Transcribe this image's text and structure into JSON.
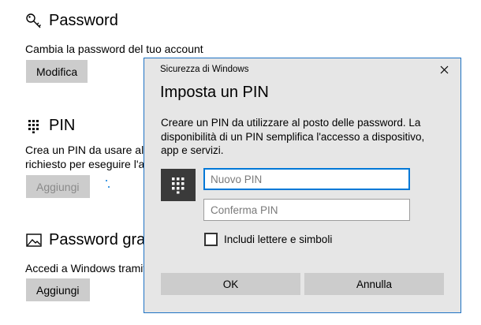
{
  "settings": {
    "password": {
      "title": "Password",
      "icon": "key-icon",
      "description": "Cambia la password del tuo account",
      "button": "Modifica"
    },
    "pin": {
      "title": "PIN",
      "icon": "keypad-icon",
      "description_line1": "Crea un PIN da usare al po",
      "description_line2": "richiesto per eseguire l'ac",
      "button": "Aggiungi"
    },
    "picture_password": {
      "title": "Password grafic",
      "icon": "picture-icon",
      "description": "Accedi a Windows tramite",
      "button": "Aggiungi"
    }
  },
  "dialog": {
    "window_title": "Sicurezza di Windows",
    "heading": "Imposta un PIN",
    "body": "Creare un PIN da utilizzare al posto delle password. La disponibilità di un PIN semplifica l'accesso a dispositivo, app e servizi.",
    "new_pin_placeholder": "Nuovo PIN",
    "confirm_pin_placeholder": "Conferma PIN",
    "checkbox_label": "Includi lettere e simboli",
    "checkbox_checked": false,
    "ok_label": "OK",
    "cancel_label": "Annulla",
    "accent_color": "#0078d7"
  }
}
